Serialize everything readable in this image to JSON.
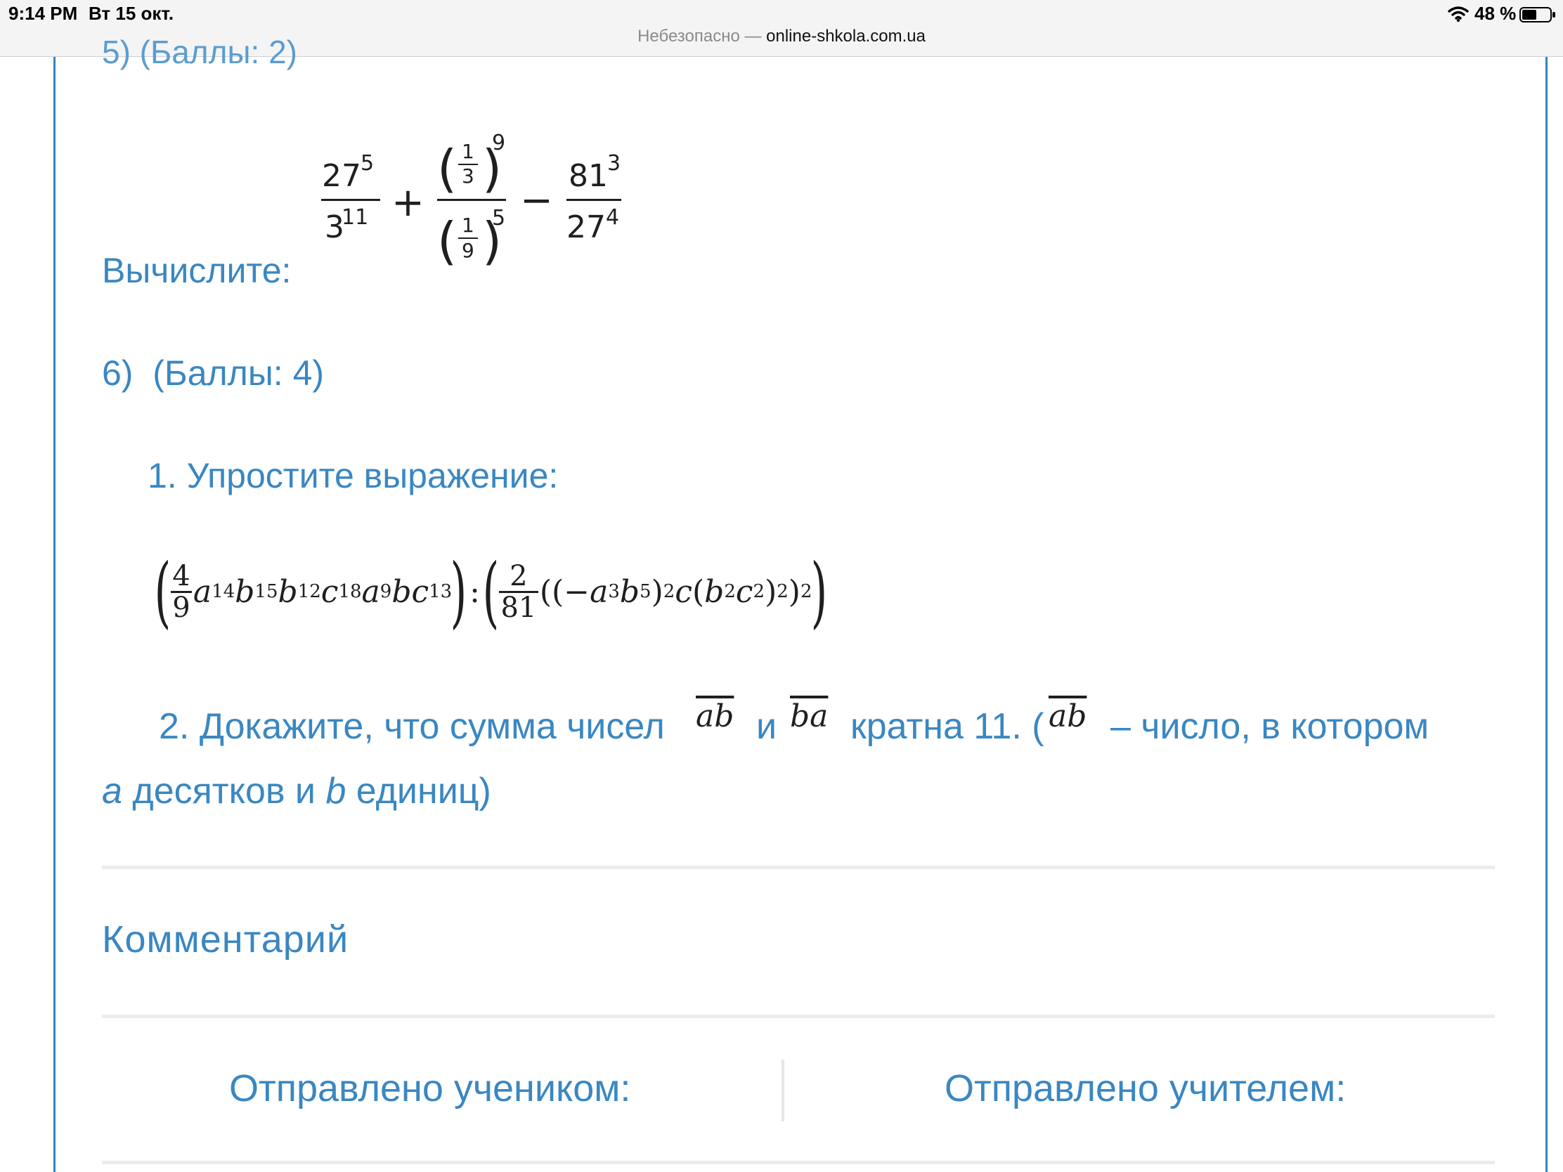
{
  "status_bar": {
    "time": "9:14 PM",
    "date": "Вт 15 окт.",
    "battery": "48 %",
    "url_prefix": "Небезопасно —",
    "url_domain": "online-shkola.com.ua"
  },
  "task5": {
    "header_partial": "5) (Баллы: 2)",
    "prompt": "Вычислите:",
    "expr": {
      "f1_num": "27",
      "f1_num_exp": "5",
      "f1_den": "3",
      "f1_den_exp": "11",
      "plus": "+",
      "f2_num_frac": [
        "1",
        "3"
      ],
      "f2_num_exp": "9",
      "f2_den_frac": [
        "1",
        "9"
      ],
      "f2_den_exp": "5",
      "minus": "−",
      "f3_num": "81",
      "f3_num_exp": "3",
      "f3_den": "27",
      "f3_den_exp": "4"
    }
  },
  "task6": {
    "header": "6)  (Баллы: 4)",
    "item1": "1. Упростите выражение:",
    "expr1": {
      "frac1": [
        "4",
        "9"
      ],
      "frac2": [
        "2",
        "81"
      ],
      "colon": ":"
    },
    "item2": {
      "text1": "2. Докажите, что сумма чисел",
      "ab": "ab",
      "and": "и",
      "ba": "ba",
      "text2": "кратна 11. (",
      "text3": "– число, в котором",
      "line2_a": "a",
      "line2_mid": " десятков и ",
      "line2_b": "b",
      "line2_end": " единиц)"
    }
  },
  "comment": {
    "title": "Комментарий"
  },
  "footer": {
    "student": "Отправлено учеником:",
    "teacher": "Отправлено учителем:"
  }
}
